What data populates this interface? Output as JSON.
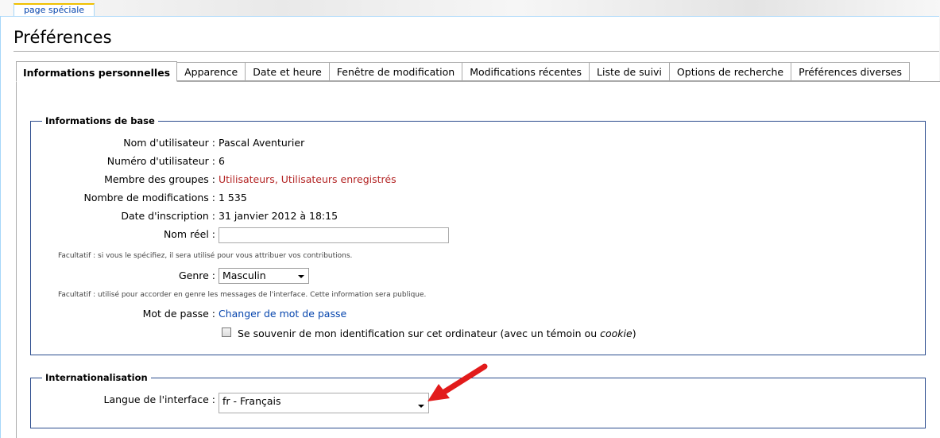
{
  "top_tab": {
    "label": "page spéciale"
  },
  "page_title": "Préférences",
  "tabs": [
    {
      "label": "Informations personnelles",
      "active": true
    },
    {
      "label": "Apparence"
    },
    {
      "label": "Date et heure"
    },
    {
      "label": "Fenêtre de modification"
    },
    {
      "label": "Modifications récentes"
    },
    {
      "label": "Liste de suivi"
    },
    {
      "label": "Options de recherche"
    },
    {
      "label": "Préférences diverses"
    }
  ],
  "basic_info": {
    "legend": "Informations de base",
    "username_label": "Nom d'utilisateur :",
    "username_value": "Pascal Aventurier",
    "user_number_label": "Numéro d'utilisateur :",
    "user_number_value": "6",
    "groups_label": "Membre des groupes :",
    "group_1": "Utilisateurs",
    "group_sep": ", ",
    "group_2": "Utilisateurs enregistrés",
    "edits_label": "Nombre de modifications :",
    "edits_value": "1 535",
    "registration_label": "Date d'inscription :",
    "registration_value": "31 janvier 2012 à 18:15",
    "real_name_label": "Nom réel :",
    "real_name_value": "",
    "real_name_note": "Facultatif : si vous le spécifiez, il sera utilisé pour vous attribuer vos contributions.",
    "gender_label": "Genre :",
    "gender_value": "Masculin",
    "gender_note": "Facultatif : utilisé pour accorder en genre les messages de l'interface. Cette information sera publique.",
    "password_label": "Mot de passe :",
    "password_link": "Changer de mot de passe",
    "remember_text": "Se souvenir de mon identification sur cet ordinateur (avec un témoin ou ",
    "remember_italic": "cookie",
    "remember_end": ")"
  },
  "intl": {
    "legend": "Internationalisation",
    "language_label": "Langue de l'interface :",
    "language_value": "fr - Français"
  },
  "colors": {
    "link_blue": "#0645ad",
    "link_red": "#b32424",
    "fieldset_border": "#2a4b8d",
    "arrow": "#e21b1b"
  }
}
